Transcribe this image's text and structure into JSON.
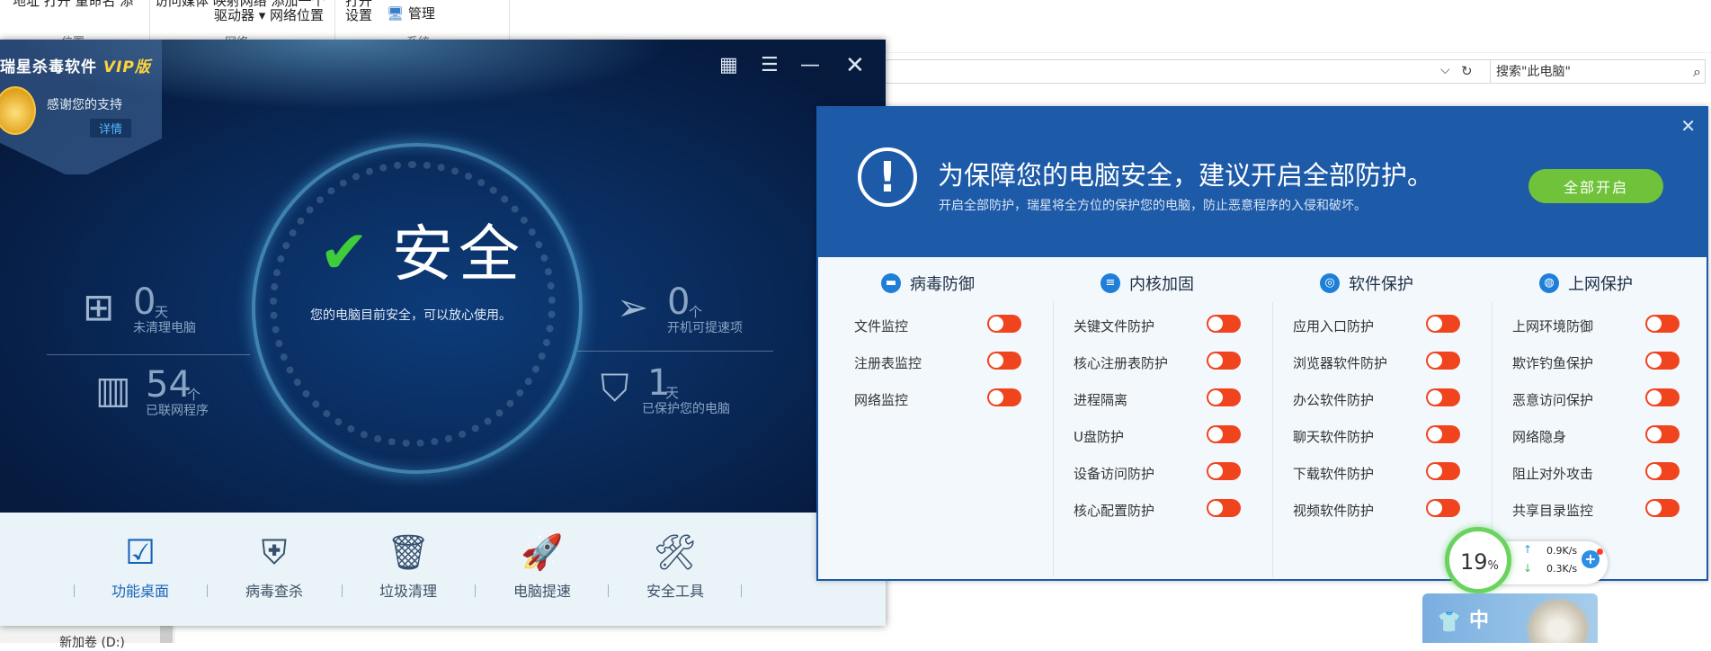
{
  "explorer": {
    "ribbon": {
      "partial_top_left": "地址 打开 重命名 添",
      "partial_top_mid": "访问媒体 映射网络 添加一个",
      "partial_top_right": "打开",
      "drive_label": "驱动器",
      "network_location": "网络位置",
      "settings": "设置",
      "manage": "管理",
      "group_location": "位置",
      "group_network": "网络",
      "group_system": "系统"
    },
    "search_placeholder": "搜索\"此电脑\"",
    "left_partial": "新加卷 (D:)"
  },
  "av": {
    "brand": "瑞星杀毒软件",
    "brand_vip": "VIP版",
    "thanks": "感谢您的支持",
    "details": "详情",
    "status": "安全",
    "status_sub": "您的电脑目前安全，可以放心使用。",
    "stats": {
      "uncleaned": {
        "num": "0",
        "unit": "天",
        "label": "未清理电脑"
      },
      "networked": {
        "num": "54",
        "unit": "个",
        "label": "已联网程序"
      },
      "boot": {
        "num": "0",
        "unit": "个",
        "label": "开机可提速项"
      },
      "protected": {
        "num": "1",
        "unit": "天",
        "label": "已保护您的电脑"
      }
    },
    "nav": [
      {
        "label": "功能桌面",
        "icon": "desktop-check-icon",
        "active": true
      },
      {
        "label": "病毒查杀",
        "icon": "shield-bolt-icon"
      },
      {
        "label": "垃圾清理",
        "icon": "trash-icon"
      },
      {
        "label": "电脑提速",
        "icon": "rocket-icon"
      },
      {
        "label": "安全工具",
        "icon": "tools-icon"
      }
    ]
  },
  "popup": {
    "title": "为保障您的电脑安全，建议开启全部防护。",
    "subtitle": "开启全部防护，瑞星将全方位的保护您的电脑，防止恶意程序的入侵和破坏。",
    "enable_all": "全部开启",
    "columns": [
      {
        "title": "病毒防御",
        "icon": "virus-defense-icon",
        "items": [
          "文件监控",
          "注册表监控",
          "网络监控"
        ]
      },
      {
        "title": "内核加固",
        "icon": "database-icon",
        "items": [
          "关键文件防护",
          "核心注册表防护",
          "进程隔离",
          "U盘防护",
          "设备访问防护",
          "核心配置防护"
        ]
      },
      {
        "title": "软件保护",
        "icon": "software-protect-icon",
        "items": [
          "应用入口防护",
          "浏览器软件防护",
          "办公软件防护",
          "聊天软件防护",
          "下载软件防护",
          "视频软件防护"
        ]
      },
      {
        "title": "上网保护",
        "icon": "globe-icon",
        "items": [
          "上网环境防御",
          "欺诈钓鱼保护",
          "恶意访问保护",
          "网络隐身",
          "阻止对外攻击",
          "共享目录监控"
        ]
      }
    ],
    "accent": "#1d5aa8",
    "toggle_color": "#f0441f"
  },
  "speed": {
    "percent": "19",
    "percent_sign": "%",
    "up": "0.9K/s",
    "down": "0.3K/s"
  },
  "ime": {
    "char": "中"
  }
}
